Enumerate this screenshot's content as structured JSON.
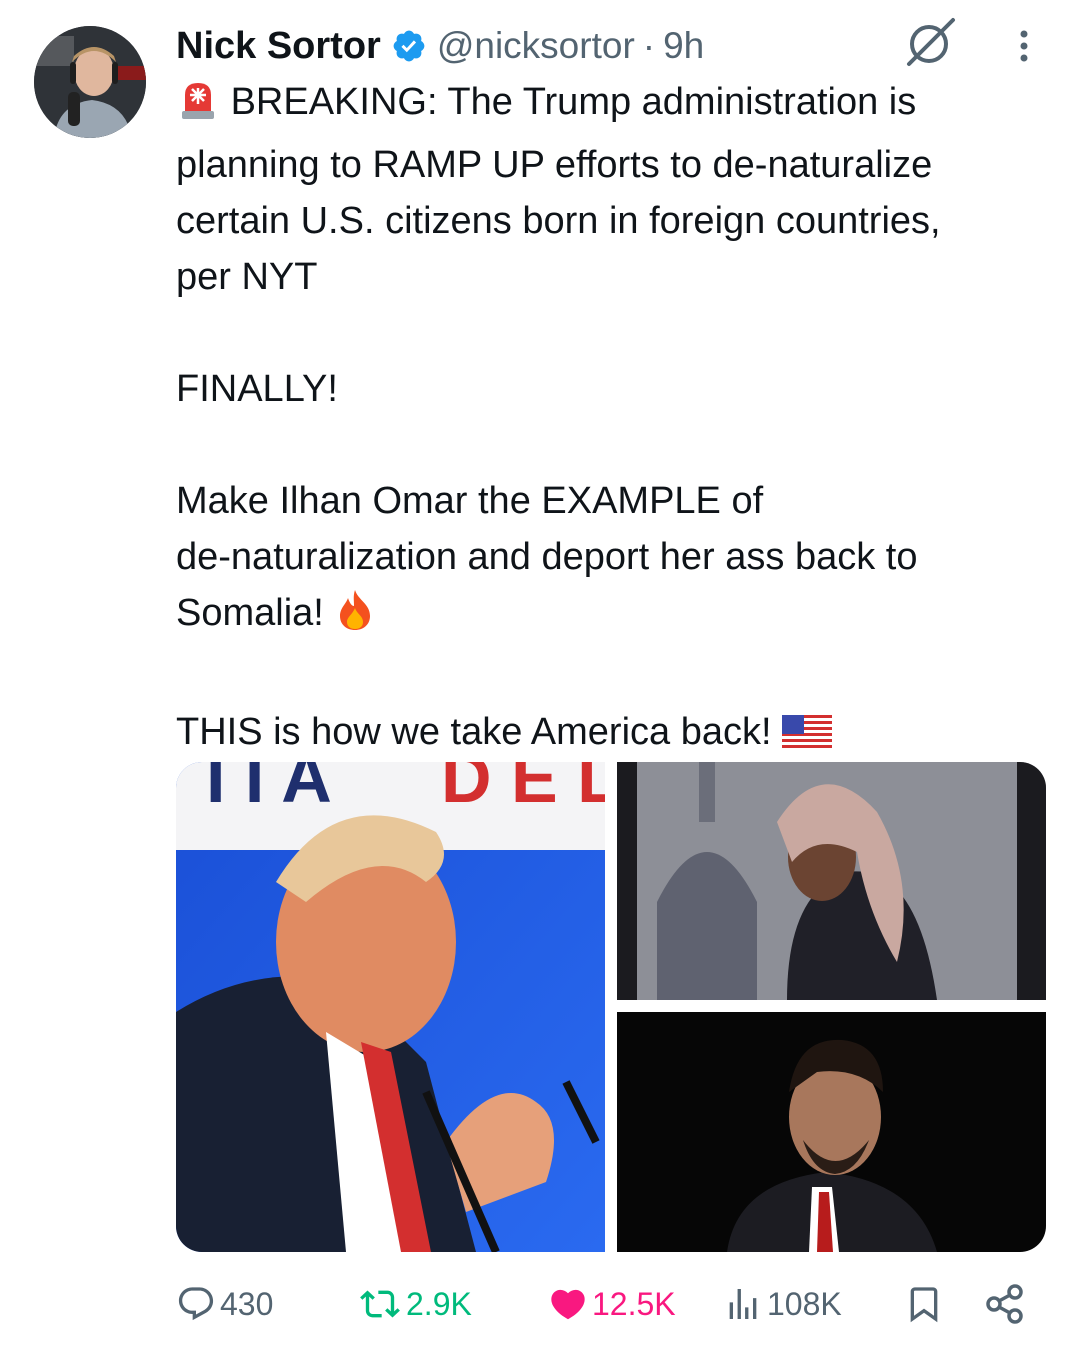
{
  "tweet": {
    "author_name": "Nick Sortor",
    "handle": "@nicksortor",
    "separator": "·",
    "time": "9h",
    "lines": [
      "BREAKING: The Trump administration is",
      "planning to RAMP UP efforts to de-naturalize",
      "certain U.S. citizens born in foreign countries,",
      "per NYT",
      "FINALLY!",
      "Make Ilhan Omar the EXAMPLE of",
      "de-naturalization and deport her ass back to",
      "Somalia!",
      "THIS is how we take America back!"
    ]
  },
  "icons": {
    "verified": "verified-badge-icon",
    "grok": "grok-icon",
    "more": "more-icon",
    "siren": "siren-emoji-icon",
    "fire": "fire-emoji-icon",
    "flag": "us-flag-emoji-icon",
    "reply": "reply-icon",
    "retweet": "retweet-icon",
    "like": "heart-icon",
    "views": "views-icon",
    "bookmark": "bookmark-icon",
    "share": "share-icon"
  },
  "metrics": {
    "replies": "430",
    "retweets": "2.9K",
    "likes": "12.5K",
    "views": "108K"
  },
  "colors": {
    "text": "#0f1419",
    "secondary": "#536471",
    "verified": "#1d9bf0",
    "retweet": "#00ba7c",
    "like": "#f91880"
  }
}
